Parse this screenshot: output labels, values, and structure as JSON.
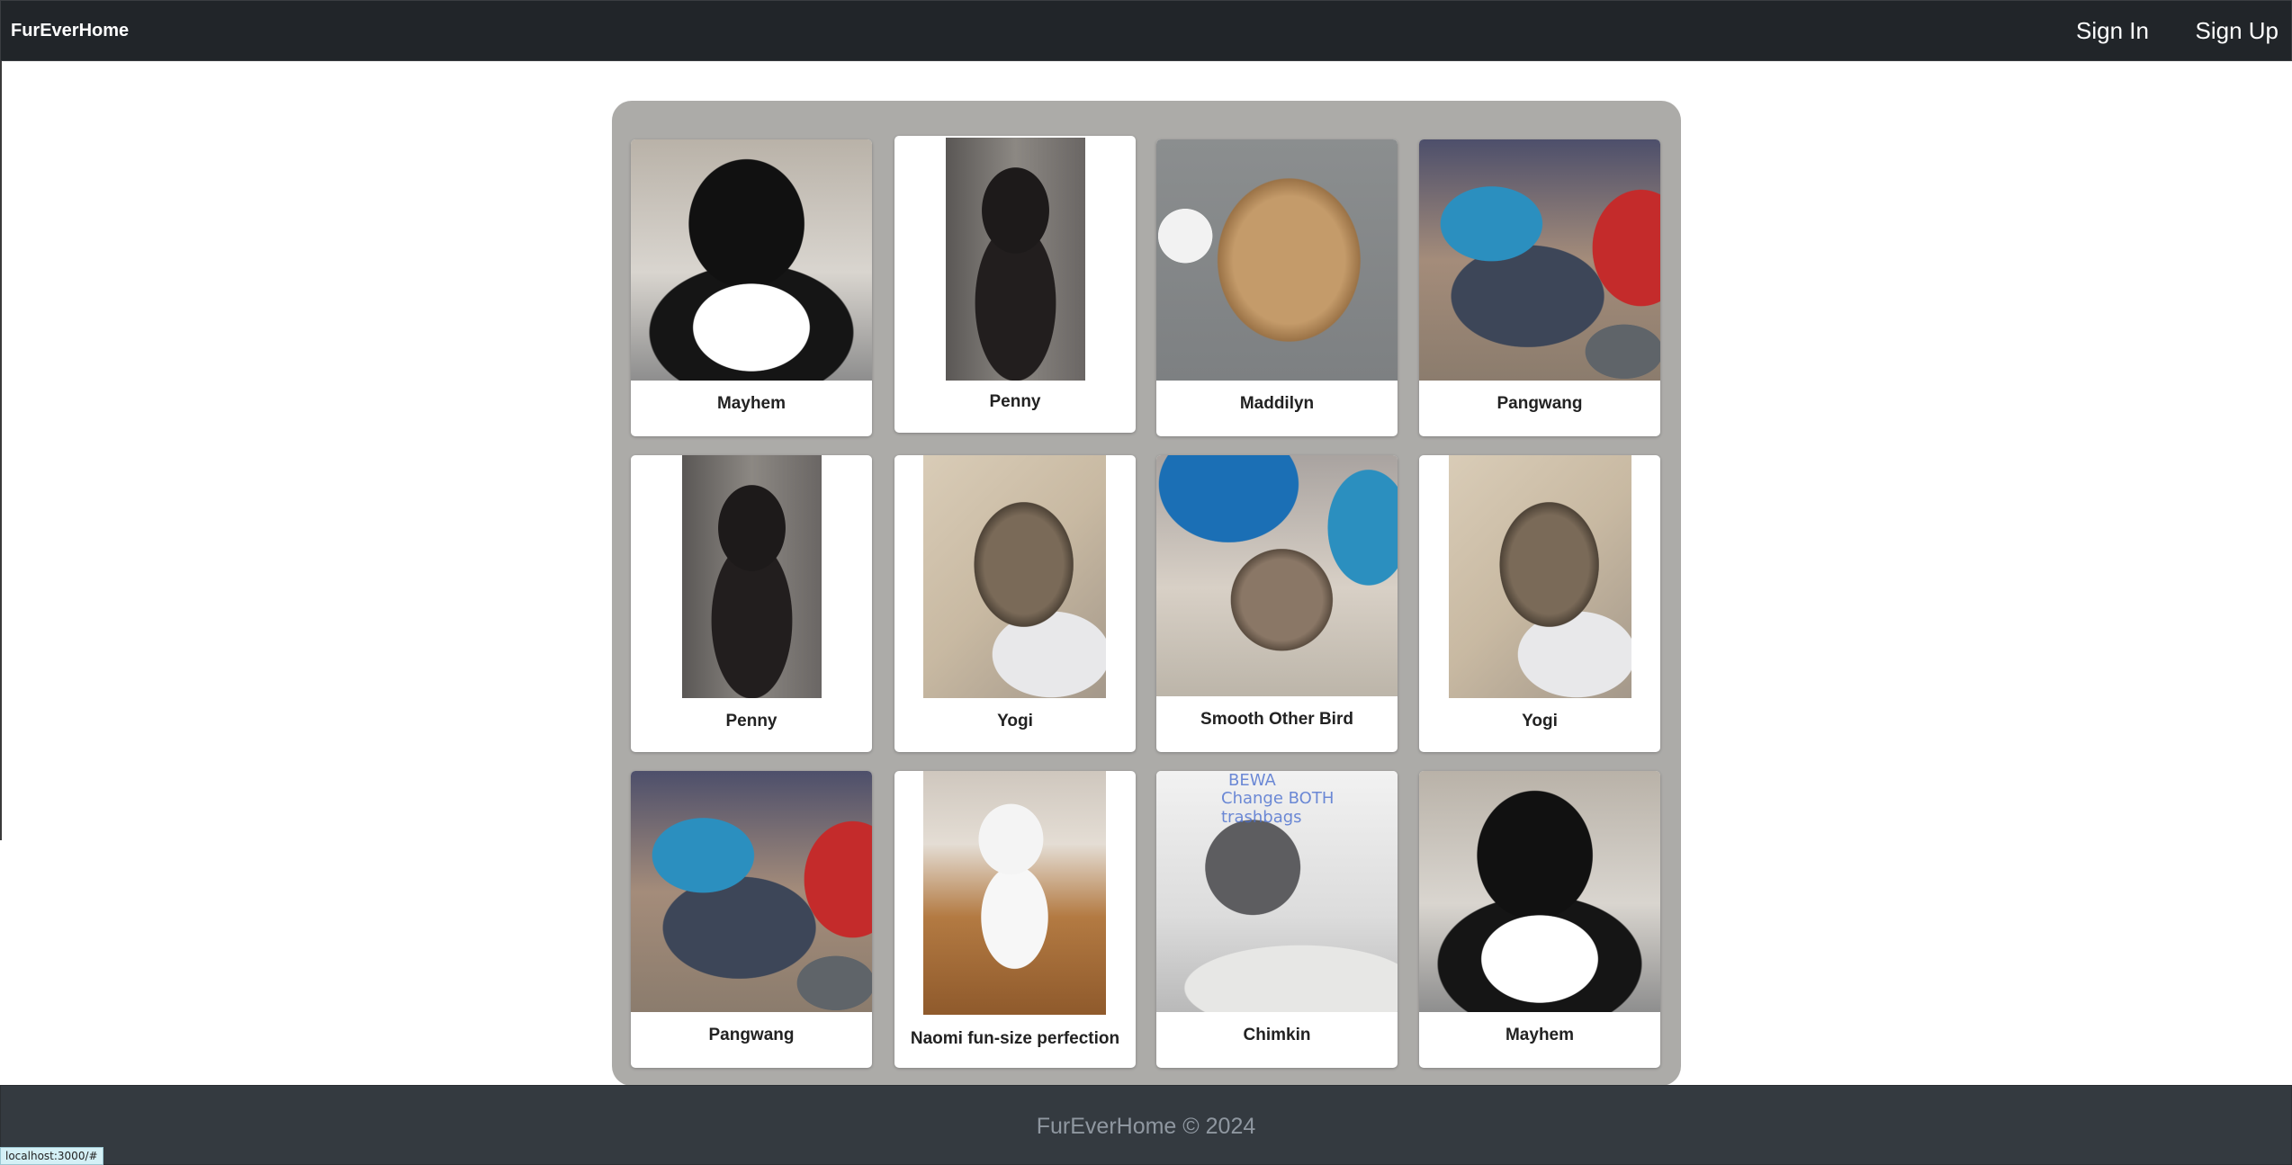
{
  "nav": {
    "brand": "FurEverHome",
    "sign_in": "Sign In",
    "sign_up": "Sign Up"
  },
  "pets": [
    {
      "name": "Mayhem",
      "photo": "tuxedo-kitten-photo"
    },
    {
      "name": "Penny",
      "photo": "black-kitten-photo"
    },
    {
      "name": "Maddilyn",
      "photo": "tan-dog-photo"
    },
    {
      "name": "Pangwang",
      "photo": "gray-cat-photo"
    },
    {
      "name": "Penny",
      "photo": "black-kitten-photo"
    },
    {
      "name": "Yogi",
      "photo": "tabby-kitten-photo"
    },
    {
      "name": "Smooth Other Bird",
      "photo": "tabby-kitten-photo"
    },
    {
      "name": "Yogi",
      "photo": "tabby-kitten-photo"
    },
    {
      "name": "Pangwang",
      "photo": "gray-cat-photo"
    },
    {
      "name": "Naomi fun-size perfection",
      "photo": "white-dog-photo"
    },
    {
      "name": "Chimkin",
      "photo": "gray-kitten-on-scale-photo"
    },
    {
      "name": "Mayhem",
      "photo": "tuxedo-kitten-photo"
    }
  ],
  "photo_text": {
    "chimkin_whiteboard_line1": "BEWA",
    "chimkin_whiteboard_line2": "Change BOTH trashbags"
  },
  "footer": {
    "text": "FurEverHome © 2024"
  },
  "status_bar": {
    "url": "localhost:3000/#"
  },
  "colors": {
    "navbar": "#212529",
    "gallery_background": "#acaba8",
    "footer": "#343a40",
    "footer_text": "#8f97a0"
  }
}
